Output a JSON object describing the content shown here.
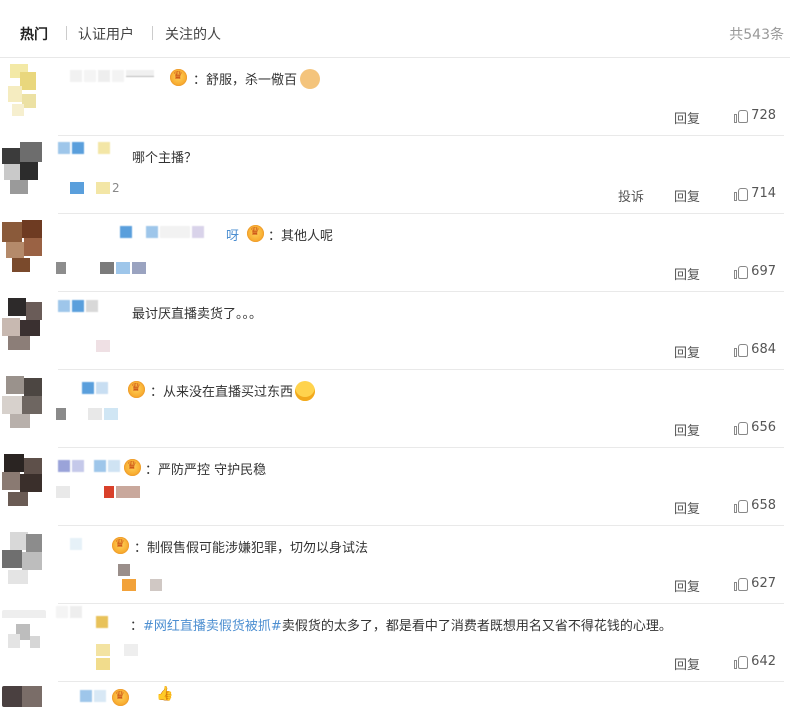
{
  "tabs": {
    "hot": "热门",
    "verified": "认证用户",
    "following": "关注的人"
  },
  "total_label": "共543条",
  "actions": {
    "reply": "回复",
    "report": "投诉"
  },
  "comments": [
    {
      "name_suffix": "",
      "extra_meta": "",
      "text_prefix": "：",
      "text": "舒服，杀一儆百",
      "likes": "728",
      "has_report": false
    },
    {
      "name_suffix": "",
      "extra_meta": "2",
      "text_prefix": "",
      "text": "哪个主播？",
      "likes": "714",
      "has_report": true
    },
    {
      "name_suffix": "呀",
      "extra_meta": "",
      "text_prefix": "：",
      "text": "其他人呢",
      "likes": "697",
      "has_report": false
    },
    {
      "name_suffix": "",
      "extra_meta": "",
      "text_prefix": "",
      "text": "最讨厌直播卖货了。。。",
      "likes": "684",
      "has_report": false
    },
    {
      "name_suffix": "",
      "extra_meta": "",
      "text_prefix": "：",
      "text": "从来没在直播买过东西",
      "likes": "656",
      "has_report": false
    },
    {
      "name_suffix": "",
      "extra_meta": "",
      "text_prefix": "：",
      "text": "严防严控 守护民稳",
      "likes": "658",
      "has_report": false
    },
    {
      "name_suffix": "",
      "extra_meta": "",
      "text_prefix": "：",
      "text": "制假售假可能涉嫌犯罪，切勿以身试法",
      "likes": "627",
      "has_report": false
    },
    {
      "name_suffix": "",
      "extra_meta": "",
      "text_prefix": "：",
      "topic": "#网红直播卖假货被抓#",
      "text": "卖假货的太多了，都是看中了消费者既想用名又省不得花钱的心理。",
      "likes": "642",
      "has_report": false
    }
  ]
}
